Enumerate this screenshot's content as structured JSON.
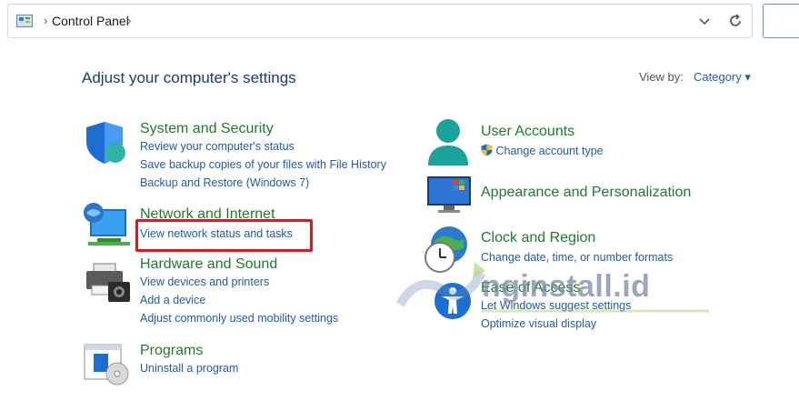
{
  "addressbar": {
    "crumb": "Control Panel",
    "sep": "›"
  },
  "page_title": "Adjust your computer's settings",
  "view_by": {
    "label": "View by:",
    "value": "Category ▾"
  },
  "categories_left": [
    {
      "title": "System and Security",
      "links": [
        "Review your computer's status",
        "Save backup copies of your files with File History",
        "Backup and Restore (Windows 7)"
      ]
    },
    {
      "title": "Network and Internet",
      "links": [
        "View network status and tasks"
      ]
    },
    {
      "title": "Hardware and Sound",
      "links": [
        "View devices and printers",
        "Add a device",
        "Adjust commonly used mobility settings"
      ]
    },
    {
      "title": "Programs",
      "links": [
        "Uninstall a program"
      ]
    }
  ],
  "categories_right": [
    {
      "title": "User Accounts",
      "links": [
        "Change account type"
      ]
    },
    {
      "title": "Appearance and Personalization",
      "links": []
    },
    {
      "title": "Clock and Region",
      "links": [
        "Change date, time, or number formats"
      ]
    },
    {
      "title": "Ease of Access",
      "links": [
        "Let Windows suggest settings",
        "Optimize visual display"
      ]
    }
  ],
  "watermark": {
    "text": "nginstall.id"
  },
  "colors": {
    "title_green": "#1e7a2e",
    "link_blue": "#1e5ba8",
    "highlight_red": "#e8141c"
  }
}
